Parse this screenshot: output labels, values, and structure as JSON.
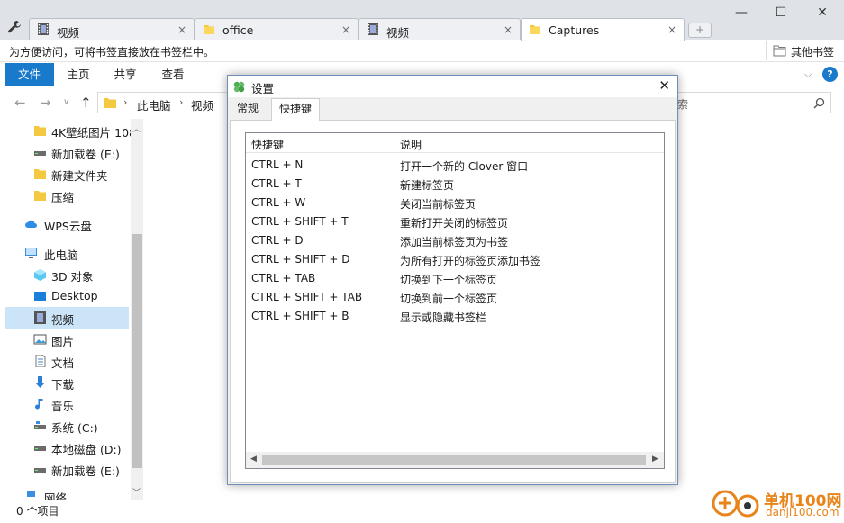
{
  "tabs": [
    {
      "label": "视频",
      "icon": "film-icon"
    },
    {
      "label": "office",
      "icon": "folder-icon"
    },
    {
      "label": "视频",
      "icon": "film-icon"
    },
    {
      "label": "Captures",
      "icon": "folder-icon"
    }
  ],
  "tab_close": "×",
  "new_tab": "+",
  "window": {
    "minimize": "—",
    "maximize": "☐",
    "close": "✕"
  },
  "bookmark_bar": {
    "hint": "为方便访问，可将书签直接放在书签栏中。",
    "other": "其他书签"
  },
  "ribbon": {
    "tabs": [
      "文件",
      "主页",
      "共享",
      "查看"
    ],
    "help": "?"
  },
  "address": {
    "crumbs": [
      "此电脑",
      "视频"
    ],
    "search_placeholder": "索"
  },
  "nav_pane": [
    {
      "label": "4K壁纸图片 108",
      "icon": "folder-icon"
    },
    {
      "label": "新加载卷 (E:)",
      "icon": "drive-icon"
    },
    {
      "label": "新建文件夹",
      "icon": "folder-icon"
    },
    {
      "label": "压缩",
      "icon": "folder-icon"
    },
    {
      "label": "WPS云盘",
      "icon": "cloud-icon"
    },
    {
      "label": "此电脑",
      "icon": "computer-icon"
    },
    {
      "label": "3D 对象",
      "icon": "cube-icon"
    },
    {
      "label": "Desktop",
      "icon": "desktop-icon"
    },
    {
      "label": "视频",
      "icon": "film-icon"
    },
    {
      "label": "图片",
      "icon": "picture-icon"
    },
    {
      "label": "文档",
      "icon": "document-icon"
    },
    {
      "label": "下载",
      "icon": "download-icon"
    },
    {
      "label": "音乐",
      "icon": "music-icon"
    },
    {
      "label": "系统 (C:)",
      "icon": "drive-icon"
    },
    {
      "label": "本地磁盘 (D:)",
      "icon": "drive-icon"
    },
    {
      "label": "新加载卷 (E:)",
      "icon": "drive-icon"
    },
    {
      "label": "网络",
      "icon": "network-icon"
    }
  ],
  "status": {
    "count": "0 个项目"
  },
  "dialog": {
    "title": "设置",
    "tabs": [
      "常规",
      "快捷键"
    ],
    "columns": [
      "快捷键",
      "说明"
    ],
    "rows": [
      {
        "key": "CTRL + N",
        "desc": "打开一个新的 Clover 窗口"
      },
      {
        "key": "CTRL + T",
        "desc": "新建标签页"
      },
      {
        "key": "CTRL + W",
        "desc": "关闭当前标签页"
      },
      {
        "key": "CTRL + SHIFT + T",
        "desc": "重新打开关闭的标签页"
      },
      {
        "key": "CTRL + D",
        "desc": "添加当前标签页为书签"
      },
      {
        "key": "CTRL + SHIFT + D",
        "desc": "为所有打开的标签页添加书签"
      },
      {
        "key": "CTRL + TAB",
        "desc": "切换到下一个标签页"
      },
      {
        "key": "CTRL + SHIFT + TAB",
        "desc": "切换到前一个标签页"
      },
      {
        "key": "CTRL + SHIFT + B",
        "desc": "显示或隐藏书签栏"
      }
    ]
  },
  "watermark": {
    "title": "单机100网",
    "sub": "danji100.com"
  },
  "colors": {
    "accent": "#1979ca",
    "selected": "#cce4f7",
    "folder": "#f5c842"
  }
}
